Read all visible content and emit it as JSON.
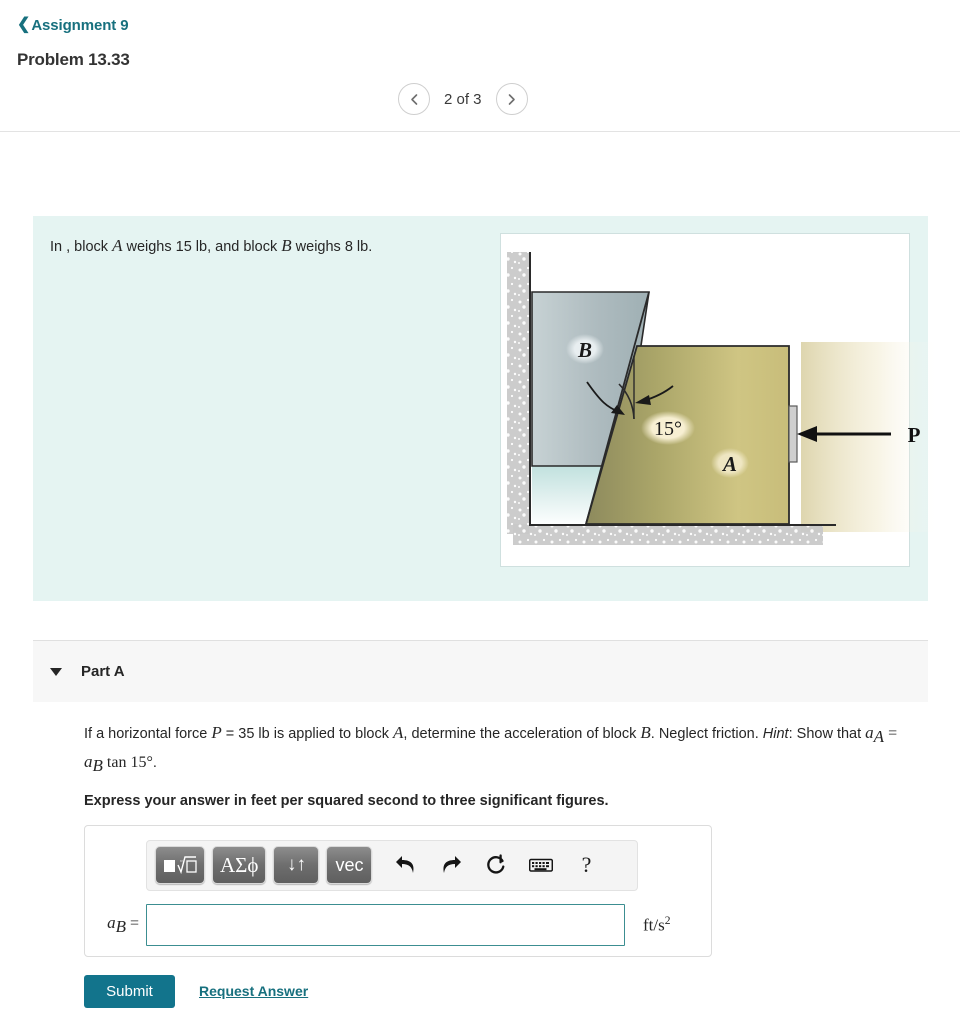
{
  "header": {
    "back_link": "Assignment 9",
    "back_icon": "chevron-left-icon",
    "problem_title": "Problem 13.33"
  },
  "pager": {
    "prev_icon": "chevron-left-icon",
    "next_icon": "chevron-right-icon",
    "label": "2 of 3",
    "current": 2,
    "total": 3
  },
  "statement": {
    "text_lead": "In , block ",
    "var_a": "A",
    "text_mid": " weighs 15 lb, and block ",
    "var_b": "B",
    "text_end": " weighs 8 lb.",
    "background_color": "#e5f4f2"
  },
  "figure": {
    "label_block_b": "B",
    "label_block_a": "A",
    "label_angle": "15°",
    "label_force": "P",
    "colors": {
      "block_a_fill": "#b5ad72",
      "block_b_fill": "#b4c2c6",
      "ground_fill": "#c9c9c9",
      "angle_badge": "#f6edce",
      "border": "#2a2a2a"
    }
  },
  "part": {
    "caret_icon": "caret-down-icon",
    "label": "Part A",
    "question": {
      "seg1": "If a horizontal force ",
      "var_p": "P",
      "seg2": " = 35 lb is applied to block ",
      "var_a": "A",
      "seg3": ", determine the acceleration of block ",
      "var_b": "B",
      "seg4": ". Neglect friction. ",
      "hint_word": "Hint",
      "seg5": ": Show that ",
      "formula": "a_A = a_B tan 15°",
      "seg6": "."
    },
    "express": "Express your answer in feet per squared second to three significant figures."
  },
  "mathbar": {
    "buttons": [
      {
        "name": "template-button",
        "label": "■√□",
        "icon": "math-template-icon"
      },
      {
        "name": "greek-button",
        "label": "ΑΣϕ",
        "icon": "greek-symbols-icon"
      },
      {
        "name": "updown-button",
        "label": "↓↑",
        "icon": "arrows-updown-icon"
      },
      {
        "name": "vec-button",
        "label": "vec",
        "icon": "vector-icon"
      }
    ],
    "icons": [
      {
        "name": "undo-button",
        "icon": "undo-arrow-icon"
      },
      {
        "name": "redo-button",
        "icon": "redo-arrow-icon"
      },
      {
        "name": "reset-button",
        "icon": "reset-circle-icon"
      },
      {
        "name": "keyboard-button",
        "icon": "keyboard-icon"
      },
      {
        "name": "help-button",
        "icon": "question-mark-icon",
        "label": "?"
      }
    ]
  },
  "answer": {
    "label_var": "a",
    "label_sub": "B",
    "label_eq": "=",
    "value": "",
    "placeholder": "",
    "units_main": "ft/s",
    "units_sup": "2",
    "border_color": "#3c8e91"
  },
  "actions": {
    "submit_label": "Submit",
    "request_label": "Request Answer",
    "submit_color": "#12748c",
    "link_color": "#17707e"
  }
}
